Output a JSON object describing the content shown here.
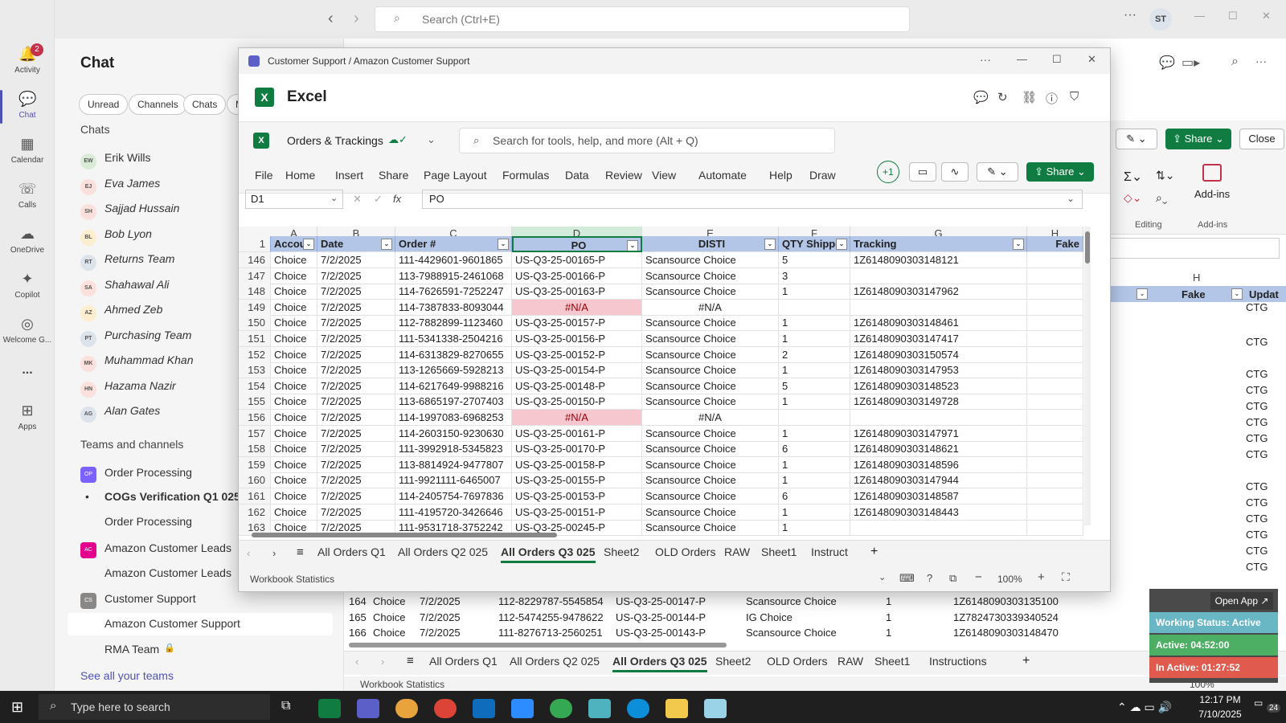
{
  "teams": {
    "search_placeholder": "Search (Ctrl+E)",
    "user_initials": "ST",
    "rail": [
      {
        "label": "Activity",
        "icon": "bell-icon",
        "badge": "2"
      },
      {
        "label": "Chat",
        "icon": "chat-icon"
      },
      {
        "label": "Calendar",
        "icon": "calendar-icon"
      },
      {
        "label": "Calls",
        "icon": "phone-icon"
      },
      {
        "label": "OneDrive",
        "icon": "cloud-icon"
      },
      {
        "label": "Copilot",
        "icon": "copilot-icon"
      },
      {
        "label": "Welcome G...",
        "icon": "welcome-icon"
      },
      {
        "label": "...",
        "icon": "more-icon"
      },
      {
        "label": "Apps",
        "icon": "apps-icon"
      }
    ],
    "chat_title": "Chat",
    "filters": [
      "Unread",
      "Channels",
      "Chats",
      "M"
    ],
    "chats_header": "Chats",
    "chats": [
      {
        "name": "Erik Wills",
        "initials": "EW",
        "color": "#d8ecd6"
      },
      {
        "name": "Eva James",
        "initials": "EJ",
        "color": "#fbe0dc"
      },
      {
        "name": "Sajjad Hussain",
        "initials": "SH",
        "color": "#fbe0dc"
      },
      {
        "name": "Bob Lyon",
        "initials": "BL",
        "color": "#fdeecf"
      },
      {
        "name": "Returns Team",
        "initials": "RT",
        "color": "#dde3ea"
      },
      {
        "name": "Shahawal Ali",
        "initials": "SA",
        "color": "#fbe0dc"
      },
      {
        "name": "Ahmed Zeb",
        "initials": "AZ",
        "color": "#fdeecf"
      },
      {
        "name": "Purchasing Team",
        "initials": "PT",
        "color": "#dde3ea"
      },
      {
        "name": "Muhammad Khan",
        "initials": "MK",
        "color": "#fbe0dc"
      },
      {
        "name": "Hazama Nazir",
        "initials": "HN",
        "color": "#fbe0dc"
      },
      {
        "name": "Alan Gates",
        "initials": "AG",
        "color": "#dde3ea"
      }
    ],
    "teams_header": "Teams and channels",
    "teams_list": [
      {
        "name": "Order Processing",
        "type": "team",
        "initials": "OP",
        "color": "#7b61ff"
      },
      {
        "name": "COGs Verification Q1 025",
        "type": "channel-bold"
      },
      {
        "name": "Order Processing",
        "type": "channel"
      },
      {
        "name": "Amazon Customer Leads",
        "type": "team",
        "initials": "AC",
        "color": "#e3008c"
      },
      {
        "name": "Amazon Customer Leads",
        "type": "channel"
      },
      {
        "name": "Customer Support",
        "type": "team",
        "initials": "CS",
        "color": "#8a8886"
      },
      {
        "name": "Amazon Customer Support",
        "type": "channel-selected"
      },
      {
        "name": "RMA Team",
        "type": "channel-locked"
      }
    ],
    "see_all": "See all your teams",
    "right_share": "Share",
    "right_close": "Close",
    "right_editing": "Editing",
    "right_addins": "Add-ins",
    "right_addins2": "Add-ins"
  },
  "excel": {
    "window_title": "Customer Support / Amazon Customer Support",
    "app_name": "Excel",
    "workbook": "Orders & Trackings",
    "search_placeholder": "Search for tools, help, and more (Alt + Q)",
    "menu": [
      "File",
      "Home",
      "Insert",
      "Share",
      "Page Layout",
      "Formulas",
      "Data",
      "Review",
      "View",
      "Automate",
      "Help",
      "Draw"
    ],
    "plus_one": "+1",
    "share": "Share",
    "name_box": "D1",
    "formula": "PO",
    "fx": "fx",
    "col_letters": [
      "A",
      "B",
      "C",
      "D",
      "E",
      "F",
      "G",
      "H"
    ],
    "headers": [
      "Accou",
      "Date",
      "Order #",
      "PO",
      "DISTI",
      "QTY Shipped",
      "Tracking",
      "Fake"
    ],
    "rows": [
      {
        "n": "146",
        "a": "Choice",
        "b": "7/2/2025",
        "c": "111-4429601-9601865",
        "d": "US-Q3-25-00165-P",
        "e": "Scansource Choice",
        "f": "5",
        "g": "1Z6148090303148121"
      },
      {
        "n": "147",
        "a": "Choice",
        "b": "7/2/2025",
        "c": "113-7988915-2461068",
        "d": "US-Q3-25-00166-P",
        "e": "Scansource Choice",
        "f": "3",
        "g": ""
      },
      {
        "n": "148",
        "a": "Choice",
        "b": "7/2/2025",
        "c": "114-7626591-7252247",
        "d": "US-Q3-25-00163-P",
        "e": "Scansource Choice",
        "f": "1",
        "g": "1Z6148090303147962"
      },
      {
        "n": "149",
        "a": "Choice",
        "b": "7/2/2025",
        "c": "114-7387833-8093044",
        "d": "#N/A",
        "e": "#N/A",
        "f": "",
        "g": ""
      },
      {
        "n": "150",
        "a": "Choice",
        "b": "7/2/2025",
        "c": "112-7882899-1123460",
        "d": "US-Q3-25-00157-P",
        "e": "Scansource Choice",
        "f": "1",
        "g": "1Z6148090303148461"
      },
      {
        "n": "151",
        "a": "Choice",
        "b": "7/2/2025",
        "c": "111-5341338-2504216",
        "d": "US-Q3-25-00156-P",
        "e": "Scansource Choice",
        "f": "1",
        "g": "1Z6148090303147417"
      },
      {
        "n": "152",
        "a": "Choice",
        "b": "7/2/2025",
        "c": "114-6313829-8270655",
        "d": "US-Q3-25-00152-P",
        "e": "Scansource Choice",
        "f": "2",
        "g": "1Z6148090303150574"
      },
      {
        "n": "153",
        "a": "Choice",
        "b": "7/2/2025",
        "c": "113-1265669-5928213",
        "d": "US-Q3-25-00154-P",
        "e": "Scansource Choice",
        "f": "1",
        "g": "1Z6148090303147953"
      },
      {
        "n": "154",
        "a": "Choice",
        "b": "7/2/2025",
        "c": "114-6217649-9988216",
        "d": "US-Q3-25-00148-P",
        "e": "Scansource Choice",
        "f": "5",
        "g": "1Z6148090303148523"
      },
      {
        "n": "155",
        "a": "Choice",
        "b": "7/2/2025",
        "c": "113-6865197-2707403",
        "d": "US-Q3-25-00150-P",
        "e": "Scansource Choice",
        "f": "1",
        "g": "1Z6148090303149728"
      },
      {
        "n": "156",
        "a": "Choice",
        "b": "7/2/2025",
        "c": "114-1997083-6968253",
        "d": "#N/A",
        "e": "#N/A",
        "f": "",
        "g": ""
      },
      {
        "n": "157",
        "a": "Choice",
        "b": "7/2/2025",
        "c": "114-2603150-9230630",
        "d": "US-Q3-25-00161-P",
        "e": "Scansource Choice",
        "f": "1",
        "g": "1Z6148090303147971"
      },
      {
        "n": "158",
        "a": "Choice",
        "b": "7/2/2025",
        "c": "111-3992918-5345823",
        "d": "US-Q3-25-00170-P",
        "e": "Scansource Choice",
        "f": "6",
        "g": "1Z6148090303148621"
      },
      {
        "n": "159",
        "a": "Choice",
        "b": "7/2/2025",
        "c": "113-8814924-9477807",
        "d": "US-Q3-25-00158-P",
        "e": "Scansource Choice",
        "f": "1",
        "g": "1Z6148090303148596"
      },
      {
        "n": "160",
        "a": "Choice",
        "b": "7/2/2025",
        "c": "111-9921111-6465007",
        "d": "US-Q3-25-00155-P",
        "e": "Scansource Choice",
        "f": "1",
        "g": "1Z6148090303147944"
      },
      {
        "n": "161",
        "a": "Choice",
        "b": "7/2/2025",
        "c": "114-2405754-7697836",
        "d": "US-Q3-25-00153-P",
        "e": "Scansource Choice",
        "f": "6",
        "g": "1Z6148090303148587"
      },
      {
        "n": "162",
        "a": "Choice",
        "b": "7/2/2025",
        "c": "111-4195720-3426646",
        "d": "US-Q3-25-00151-P",
        "e": "Scansource Choice",
        "f": "1",
        "g": "1Z6148090303148443"
      },
      {
        "n": "163",
        "a": "Choice",
        "b": "7/2/2025",
        "c": "111-9531718-3752242",
        "d": "US-Q3-25-00245-P",
        "e": "Scansource Choice",
        "f": "1",
        "g": ""
      }
    ],
    "sheet_tabs": [
      "All Orders Q1",
      "All Orders Q2 025",
      "All Orders Q3 025",
      "Sheet2",
      "OLD Orders",
      "RAW",
      "Sheet1",
      "Instruct"
    ],
    "active_tab": "All Orders Q3 025",
    "status_left": "Workbook Statistics",
    "zoom": "100%"
  },
  "background_sheet": {
    "rows": [
      {
        "n": "164",
        "a": "Choice",
        "b": "7/2/2025",
        "c": "112-8229787-5545854",
        "d": "US-Q3-25-00147-P",
        "e": "Scansource Choice",
        "f": "1",
        "g": "1Z6148090303135100"
      },
      {
        "n": "165",
        "a": "Choice",
        "b": "7/2/2025",
        "c": "112-5474255-9478622",
        "d": "US-Q3-25-00144-P",
        "e": "IG Choice",
        "f": "1",
        "g": "1Z7824730339340524"
      },
      {
        "n": "166",
        "a": "Choice",
        "b": "7/2/2025",
        "c": "111-8276713-2560251",
        "d": "US-Q3-25-00143-P",
        "e": "Scansource Choice",
        "f": "1",
        "g": "1Z6148090303148470"
      }
    ],
    "sheet_tabs": [
      "All Orders Q1",
      "All Orders Q2 025",
      "All Orders Q3 025",
      "Sheet2",
      "OLD Orders",
      "RAW",
      "Sheet1",
      "Instructions"
    ],
    "status_left": "Workbook Statistics",
    "zoom": "100%",
    "header_h": "H",
    "header_fake": "Fake",
    "header_update": "Updat",
    "ctg": "CTG"
  },
  "status_widget": {
    "open_app": "Open App ↗",
    "working": "Working Status: Active",
    "active": "Active: 04:52:00",
    "inactive": "In Active: 01:27:52"
  },
  "taskbar": {
    "search_placeholder": "Type here to search",
    "time": "12:17 PM",
    "date": "7/10/2025",
    "notif": "24"
  }
}
